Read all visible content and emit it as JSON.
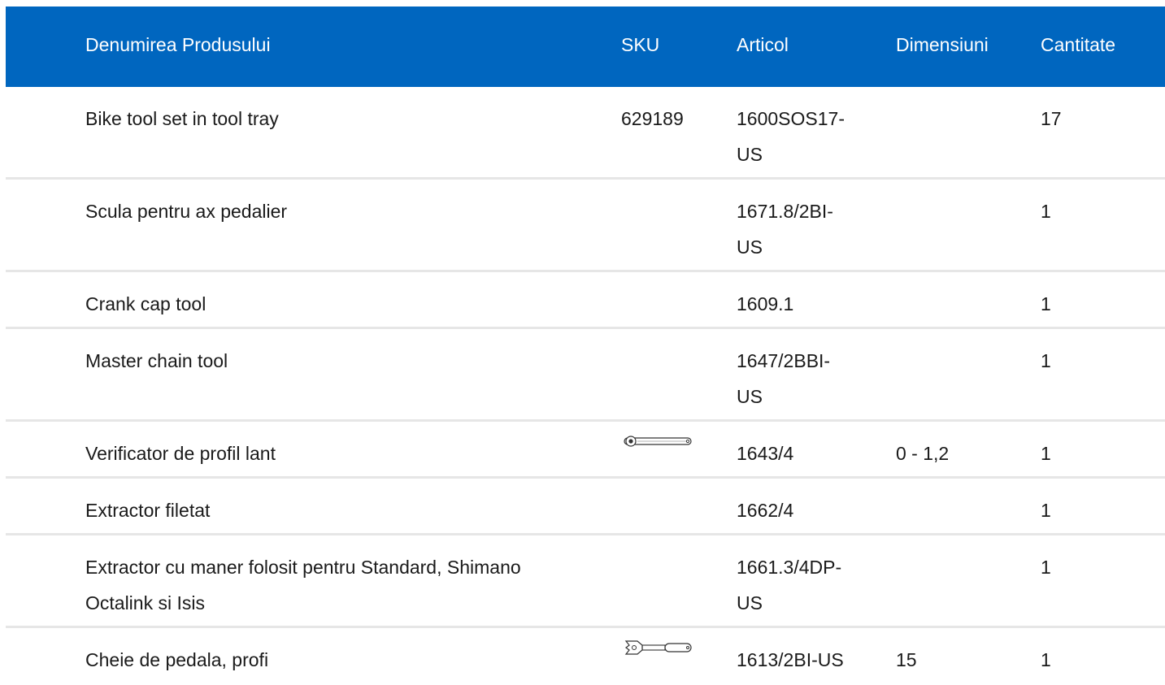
{
  "header": {
    "name": "Denumirea Produsului",
    "sku": "SKU",
    "article": "Articol",
    "dimensions": "Dimensiuni",
    "quantity": "Cantitate"
  },
  "rows": [
    {
      "name": "Bike tool set in tool tray",
      "sku": "629189",
      "article": "1600SOS17-US",
      "dimensions": "",
      "quantity": "17",
      "image": ""
    },
    {
      "name": "Scula pentru ax pedalier",
      "sku": "",
      "article": "1671.8/2BI-US",
      "dimensions": "",
      "quantity": "1",
      "image": ""
    },
    {
      "name": "Crank cap tool",
      "sku": "",
      "article": "1609.1",
      "dimensions": "",
      "quantity": "1",
      "image": ""
    },
    {
      "name": "Master chain tool",
      "sku": "",
      "article": "1647/2BBI-US",
      "dimensions": "",
      "quantity": "1",
      "image": ""
    },
    {
      "name": "Verificator de profil lant",
      "sku": "",
      "article": "1643/4",
      "dimensions": "0 - 1,2",
      "quantity": "1",
      "image": "chain-gauge-icon"
    },
    {
      "name": "Extractor filetat",
      "sku": "",
      "article": "1662/4",
      "dimensions": "",
      "quantity": "1",
      "image": ""
    },
    {
      "name": "Extractor cu maner folosit pentru Standard, Shimano Octalink si Isis",
      "sku": "",
      "article": "1661.3/4DP-US",
      "dimensions": "",
      "quantity": "1",
      "image": ""
    },
    {
      "name": "Cheie de pedala, profi",
      "sku": "",
      "article": "1613/2BI-US",
      "dimensions": "15",
      "quantity": "1",
      "image": "pedal-wrench-icon"
    }
  ]
}
